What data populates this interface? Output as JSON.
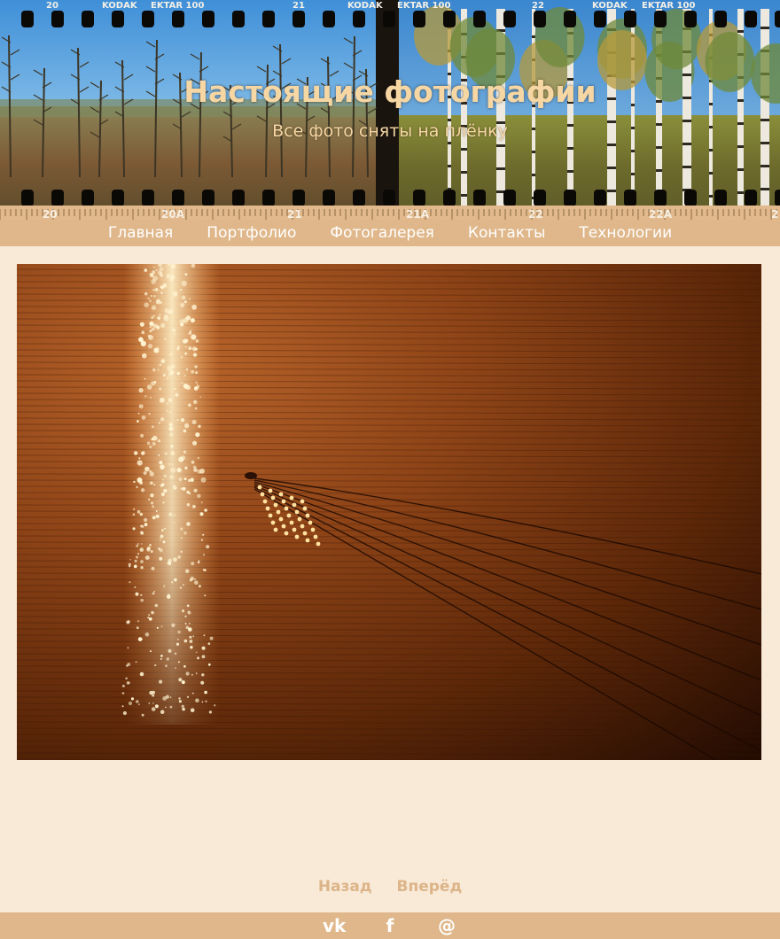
{
  "header": {
    "title": "Настоящие фотографии",
    "subtitle": "Все фото сняты на плёнку",
    "film_marks": {
      "top": [
        "20",
        "KODAK",
        "EKTAR 100",
        "21",
        "KODAK",
        "EKTAR 100",
        "22",
        "KODAK",
        "EKTAR 100"
      ],
      "bottom": [
        "20",
        "20A",
        "21",
        "21A",
        "22",
        "22A",
        "2"
      ]
    },
    "background_image": "film-strip-forest-photo"
  },
  "nav": {
    "items": [
      {
        "label": "Главная"
      },
      {
        "label": "Портфолио"
      },
      {
        "label": "Фотогалерея"
      },
      {
        "label": "Контакты"
      },
      {
        "label": "Технологии"
      }
    ]
  },
  "main": {
    "photo": "sunset-lake-boat-photo"
  },
  "pager": {
    "prev_label": "Назад",
    "next_label": "Вперёд"
  },
  "footer": {
    "social": [
      {
        "icon": "vk-icon",
        "glyph": "vk"
      },
      {
        "icon": "facebook-icon",
        "glyph": "f"
      },
      {
        "icon": "mail-ru-icon",
        "glyph": "@"
      }
    ]
  },
  "colors": {
    "page_background": "#f9ead7",
    "nav_background": "#dfb78a",
    "title_color": "#f6d7a4",
    "pager_link": "#dcb489",
    "nav_text": "#ffffff"
  }
}
